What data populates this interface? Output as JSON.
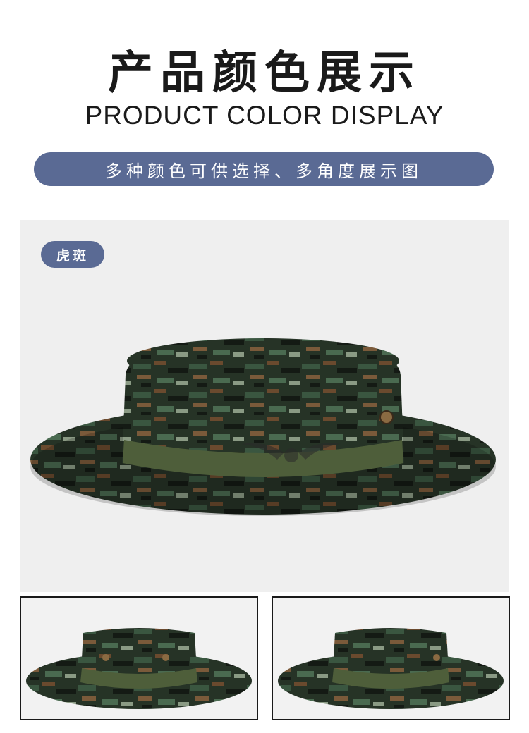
{
  "header": {
    "title_cn": "产品颜色展示",
    "title_en": "PRODUCT COLOR DISPLAY"
  },
  "banner": {
    "text": "多种颜色可供选择、多角度展示图"
  },
  "main": {
    "color_tag": "虎斑",
    "image": "camouflage-bucket-hat-front"
  },
  "thumbnails": [
    {
      "image": "camouflage-bucket-hat-side-left"
    },
    {
      "image": "camouflage-bucket-hat-side-right"
    }
  ],
  "colors": {
    "accent": "#5a6a94",
    "panel_bg": "#efefef",
    "camo_dark": "#1f2a1f",
    "camo_green": "#2f4a34",
    "camo_brown": "#6a4a2e",
    "band": "#4e5e3a"
  }
}
